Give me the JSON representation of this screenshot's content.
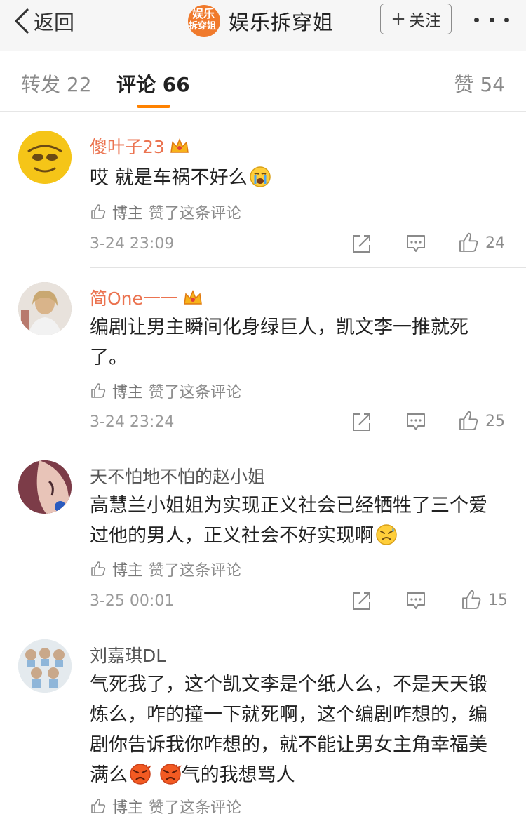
{
  "nav": {
    "back_label": "返回",
    "title": "娱乐拆穿姐",
    "logo_text_top": "娱乐",
    "logo_text_bottom": "拆穿姐",
    "follow_plus": "+",
    "follow_label": "关注"
  },
  "tabs": {
    "repost": "转发 22",
    "comment": "评论 66",
    "like": "赞 54",
    "active": "comment"
  },
  "colors": {
    "accent": "#ff8200",
    "vip_name": "#eb7350",
    "brand": "#f07a2c"
  },
  "comments": [
    {
      "username": "傻叶子23",
      "vip": true,
      "text": "哎 就是车祸不好么",
      "emoji": "crying-face",
      "liked_by_author": "博主",
      "liked_by_suffix": "赞了这条评论",
      "time": "3-24 23:09",
      "likes": "24"
    },
    {
      "username": "简One一一",
      "vip": true,
      "text": "编剧让男主瞬间化身绿巨人，凯文李一推就死了。",
      "liked_by_author": "博主",
      "liked_by_suffix": "赞了这条评论",
      "time": "3-24 23:24",
      "likes": "25"
    },
    {
      "username": "天不怕地不怕的赵小姐",
      "vip": false,
      "text": "高慧兰小姐姐为实现正义社会已经牺牲了三个爱过他的男人，正义社会不好实现啊",
      "emoji": "sweating-face",
      "liked_by_author": "博主",
      "liked_by_suffix": "赞了这条评论",
      "time": "3-25 00:01",
      "likes": "15"
    },
    {
      "username": "刘嘉琪DL",
      "vip": false,
      "text_part1": "气死我了，这个凯文李是个纸人么，不是天天锻炼么，咋的撞一下就死啊，这个编剧咋想的，编剧你告诉我你咋想的，就不能让男女主角幸福美满么",
      "text_part2": "气的我想骂人",
      "emoji": "angry-face",
      "liked_by_author": "博主",
      "liked_by_suffix": "赞了这条评论"
    }
  ]
}
